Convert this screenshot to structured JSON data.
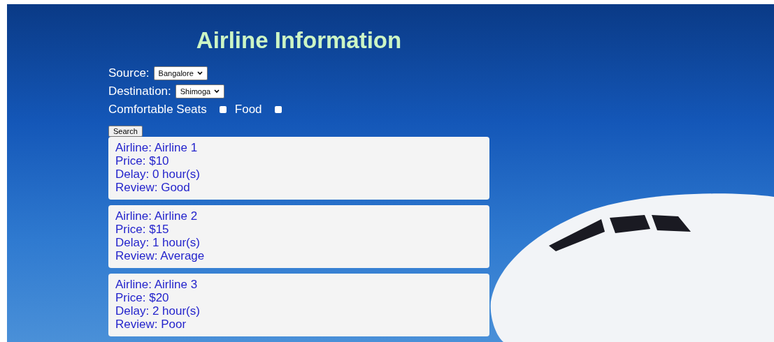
{
  "title": "Airline Information",
  "source": {
    "label": "Source:",
    "value": "Bangalore"
  },
  "destination": {
    "label": "Destination:",
    "value": "Shimoga"
  },
  "options": [
    {
      "label": "Comfortable Seats",
      "checked": false
    },
    {
      "label": "Food",
      "checked": false
    }
  ],
  "search_button": "Search",
  "results": [
    {
      "lines": [
        "Airline: Airline 1",
        "Price: $10",
        "Delay: 0 hour(s)",
        "Review: Good"
      ]
    },
    {
      "lines": [
        "Airline: Airline 2",
        "Price: $15",
        "Delay: 1 hour(s)",
        "Review: Average"
      ]
    },
    {
      "lines": [
        "Airline: Airline 3",
        "Price: $20",
        "Delay: 2 hour(s)",
        "Review: Poor"
      ]
    }
  ]
}
